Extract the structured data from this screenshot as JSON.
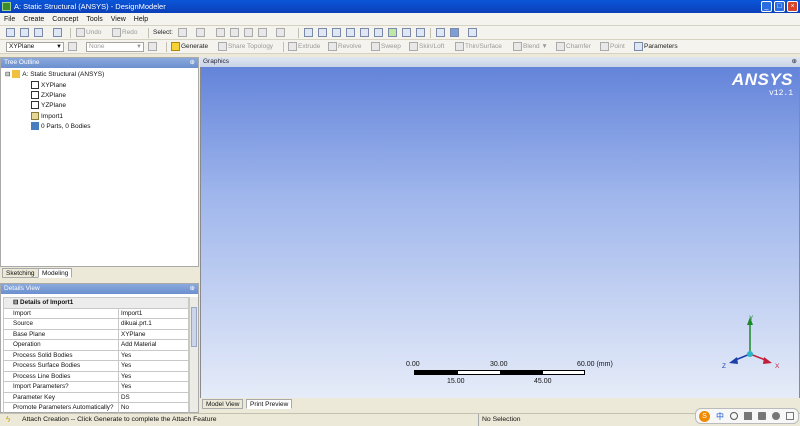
{
  "window": {
    "title": "A: Static Structural (ANSYS) - DesignModeler"
  },
  "menu": [
    "File",
    "Create",
    "Concept",
    "Tools",
    "View",
    "Help"
  ],
  "toolbar1": {
    "undo": "Undo",
    "redo": "Redo",
    "select": "Select:"
  },
  "toolbar2": {
    "plane_value": "XYPlane",
    "sketch_value": "None",
    "generate": "Generate",
    "share_topology": "Share Topology",
    "extrude": "Extrude",
    "revolve": "Revolve",
    "sweep": "Sweep",
    "skin_loft": "Skin/Loft",
    "thin_surface": "Thin/Surface",
    "blend": "Blend",
    "chamfer": "Chamfer",
    "point": "Point",
    "parameters": "Parameters"
  },
  "tree": {
    "header": "Tree Outline",
    "items": [
      "A: Static Structural (ANSYS)",
      "XYPlane",
      "ZXPlane",
      "YZPlane",
      "Import1",
      "0 Parts, 0 Bodies"
    ]
  },
  "left_tabs": [
    "Sketching",
    "Modeling"
  ],
  "details": {
    "header": "Details View",
    "group": "Details of Import1",
    "rows": [
      {
        "k": "Import",
        "v": "Import1"
      },
      {
        "k": "Source",
        "v": "dikuai.prt.1"
      },
      {
        "k": "Base Plane",
        "v": "XYPlane"
      },
      {
        "k": "Operation",
        "v": "Add Material"
      },
      {
        "k": "Process Solid Bodies",
        "v": "Yes"
      },
      {
        "k": "Process Surface Bodies",
        "v": "Yes"
      },
      {
        "k": "Process Line Bodies",
        "v": "Yes"
      },
      {
        "k": "Import Parameters?",
        "v": "Yes"
      },
      {
        "k": "Parameter Key",
        "v": "DS"
      },
      {
        "k": "Promote Parameters Automatically?",
        "v": "No"
      }
    ]
  },
  "graphics": {
    "header": "Graphics",
    "logo": "ANSYS",
    "version": "v12.1",
    "scale_top": [
      "0.00",
      "30.00",
      "60.00 (mm)"
    ],
    "scale_bottom": [
      "15.00",
      "45.00"
    ],
    "triad": {
      "x": "X",
      "y": "Y",
      "z": "Z"
    }
  },
  "bottom_tabs": [
    "Model View",
    "Print Preview"
  ],
  "status": {
    "message": "Attach Creation -- Click Generate to complete the Attach Feature",
    "selection": "No Selection",
    "ime": "中"
  },
  "colors": {
    "gfx_top": "#5f80d8",
    "gfx_bottom": "#e6ecf8",
    "titlebar": "#0a56d8"
  }
}
